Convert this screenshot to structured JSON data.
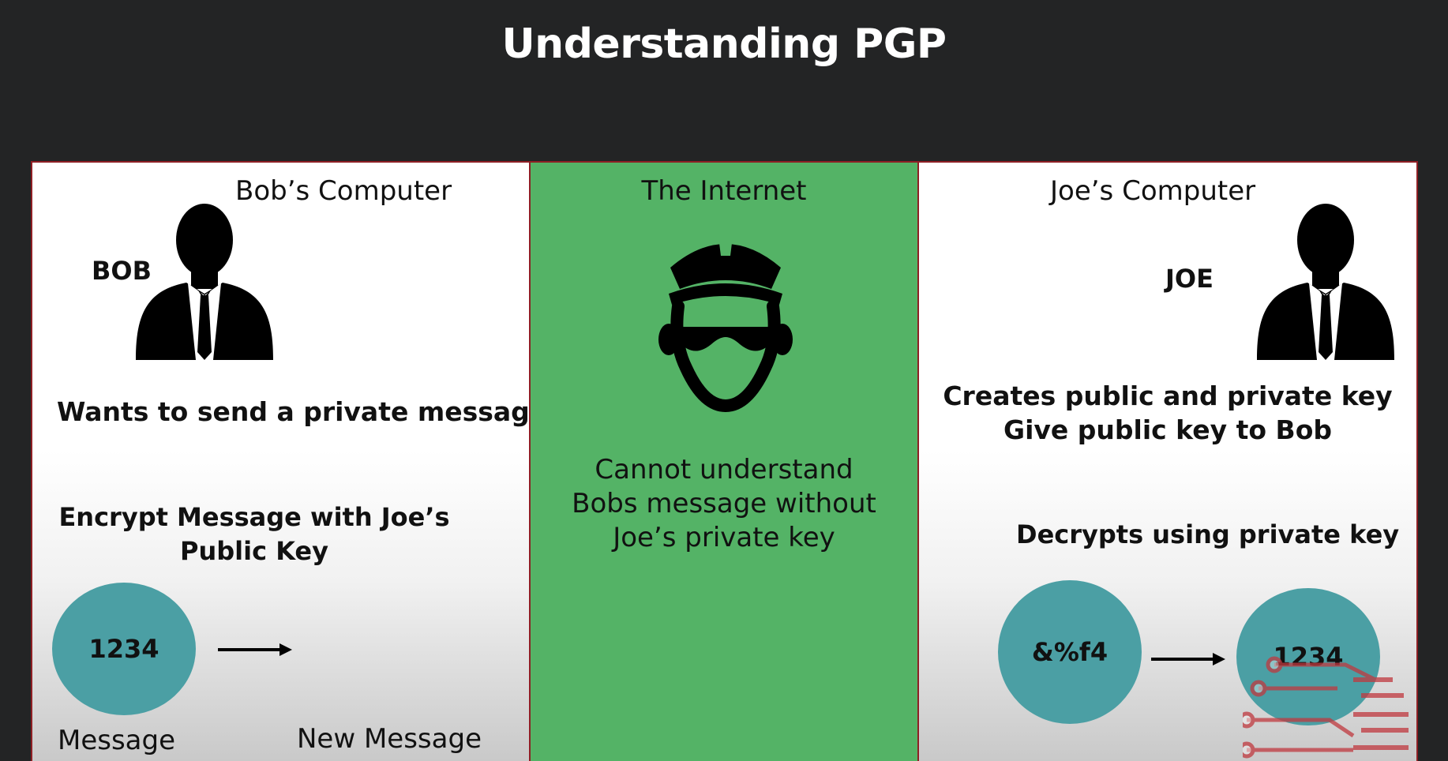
{
  "title": "Understanding PGP",
  "bob": {
    "heading": "Bob’s Computer",
    "name_label": "BOB",
    "statement": "Wants to send a private message",
    "step_line1": "Encrypt Message with Joe’s",
    "step_line2": "Public Key",
    "circle_value": "1234",
    "caption_left": "Message",
    "caption_right": "New Message"
  },
  "internet": {
    "heading": "The Internet",
    "line1": "Cannot understand",
    "line2": "Bobs message without",
    "line3": "Joe’s private key"
  },
  "joe": {
    "heading": "Joe’s Computer",
    "name_label": "JOE",
    "statement_line1": "Creates public and private key",
    "statement_line2": "Give public key to Bob",
    "step": "Decrypts using private key",
    "circle_encrypted": "&%f4",
    "circle_decrypted": "1234"
  },
  "colors": {
    "background": "#232425",
    "panel_border": "#8e1f24",
    "internet_green": "#54b366",
    "circle_teal": "#4b9fa4",
    "watermark_red": "#c0393f"
  },
  "icons": {
    "bob": "businessman-silhouette-icon",
    "joe": "businessman-silhouette-icon",
    "internet": "police-officer-icon",
    "watermark": "circuit-logo-watermark"
  }
}
